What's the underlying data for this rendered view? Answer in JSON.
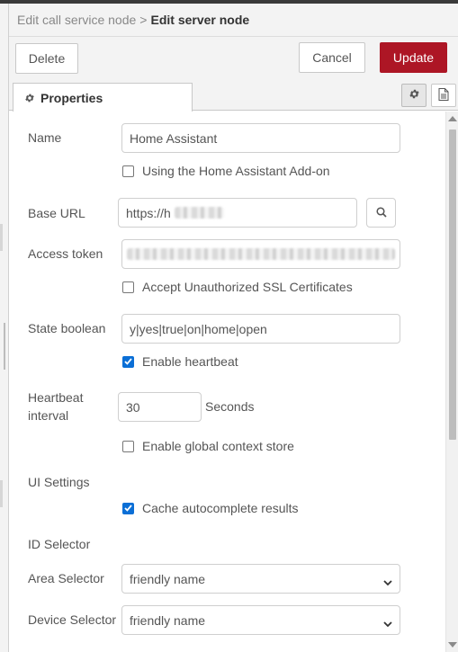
{
  "breadcrumb": {
    "parent": "Edit call service node",
    "separator": ">",
    "current": "Edit server node"
  },
  "buttons": {
    "delete": "Delete",
    "cancel": "Cancel",
    "update": "Update"
  },
  "tabs": {
    "properties": "Properties"
  },
  "form": {
    "name_label": "Name",
    "name_value": "Home Assistant",
    "addon_label": "Using the Home Assistant Add-on",
    "addon_checked": false,
    "base_url_label": "Base URL",
    "base_url_value": "https://h",
    "access_token_label": "Access token",
    "ssl_label": "Accept Unauthorized SSL Certificates",
    "ssl_checked": false,
    "state_boolean_label": "State boolean",
    "state_boolean_value": "y|yes|true|on|home|open",
    "heartbeat_enable_label": "Enable heartbeat",
    "heartbeat_enable_checked": true,
    "heartbeat_interval_label_line1": "Heartbeat",
    "heartbeat_interval_label_line2": "interval",
    "heartbeat_interval_value": "30",
    "heartbeat_interval_unit": "Seconds",
    "global_context_label": "Enable global context store",
    "global_context_checked": false,
    "ui_settings_label": "UI Settings",
    "cache_label": "Cache autocomplete results",
    "cache_checked": true,
    "id_selector_label": "ID Selector",
    "area_selector_label": "Area Selector",
    "area_selector_value": "friendly name",
    "device_selector_label": "Device Selector",
    "device_selector_value": "friendly name"
  },
  "icons": {
    "tab_gear": "gear-icon",
    "settings": "gear-icon",
    "description": "document-icon",
    "search": "search-icon",
    "dropdown": "chevron-down-icon"
  },
  "colors": {
    "update_button": "#ad1625",
    "checkbox_checked": "#0b6fd6"
  }
}
